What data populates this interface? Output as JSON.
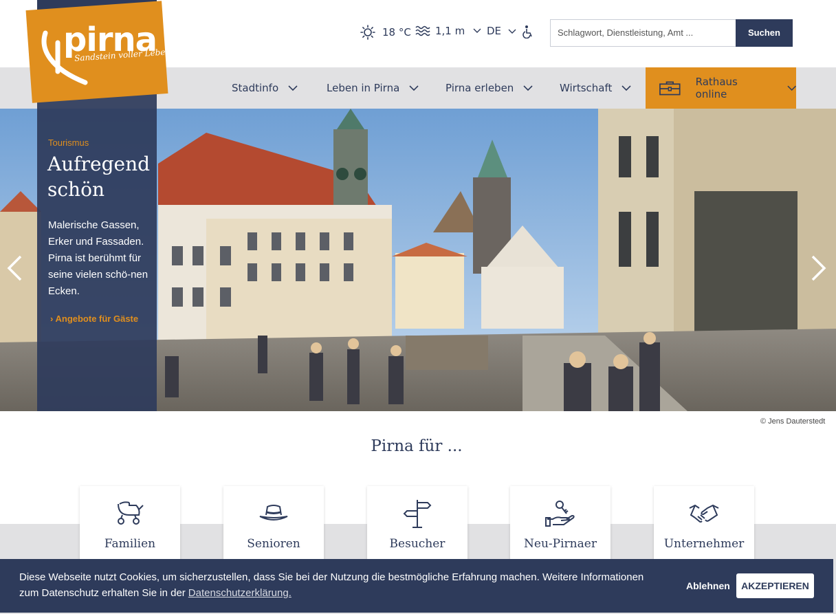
{
  "logo": {
    "name": "pirna",
    "tagline": "Sandstein voller Leben"
  },
  "util": {
    "weather_temp": "18 °C",
    "water_level": "1,1 m",
    "language": "DE"
  },
  "search": {
    "placeholder": "Schlagwort, Dienstleistung, Amt ...",
    "button_label": "Suchen"
  },
  "nav": {
    "items": [
      {
        "label": "Stadtinfo"
      },
      {
        "label": "Leben in Pirna"
      },
      {
        "label": "Pirna erleben"
      },
      {
        "label": "Wirtschaft"
      }
    ],
    "rathaus_label": "Rathaus online"
  },
  "hero": {
    "tag": "Tourismus",
    "title": "Aufregend schön",
    "text": "Malerische Gassen, Erker und Fassaden. Pirna ist berühmt für seine vielen schö-nen Ecken.",
    "link": "Angebote für Gäste",
    "credit": "© Jens Dauterstedt"
  },
  "section": {
    "title": "Pirna für ..."
  },
  "cards": [
    {
      "label": "Familien",
      "icon": "stroller-icon"
    },
    {
      "label": "Senioren",
      "icon": "hat-icon"
    },
    {
      "label": "Besucher",
      "icon": "signpost-icon"
    },
    {
      "label": "Neu-Pirnaer",
      "icon": "key-hand-icon"
    },
    {
      "label": "Unternehmer",
      "icon": "handshake-icon"
    }
  ],
  "cookie": {
    "text": "Diese Webseite nutzt Cookies, um sicherzustellen, dass Sie bei der Nutzung die bestmögliche Erfahrung machen. Weitere Informationen zum Datenschutz erhalten Sie in der",
    "link": "Datenschutzerklärung.",
    "decline": "Ablehnen",
    "accept": "AKZEPTIEREN"
  },
  "colors": {
    "brand_orange": "#e08f1e",
    "brand_navy": "#2e3b5b",
    "nav_gray": "#e1e1e3"
  }
}
